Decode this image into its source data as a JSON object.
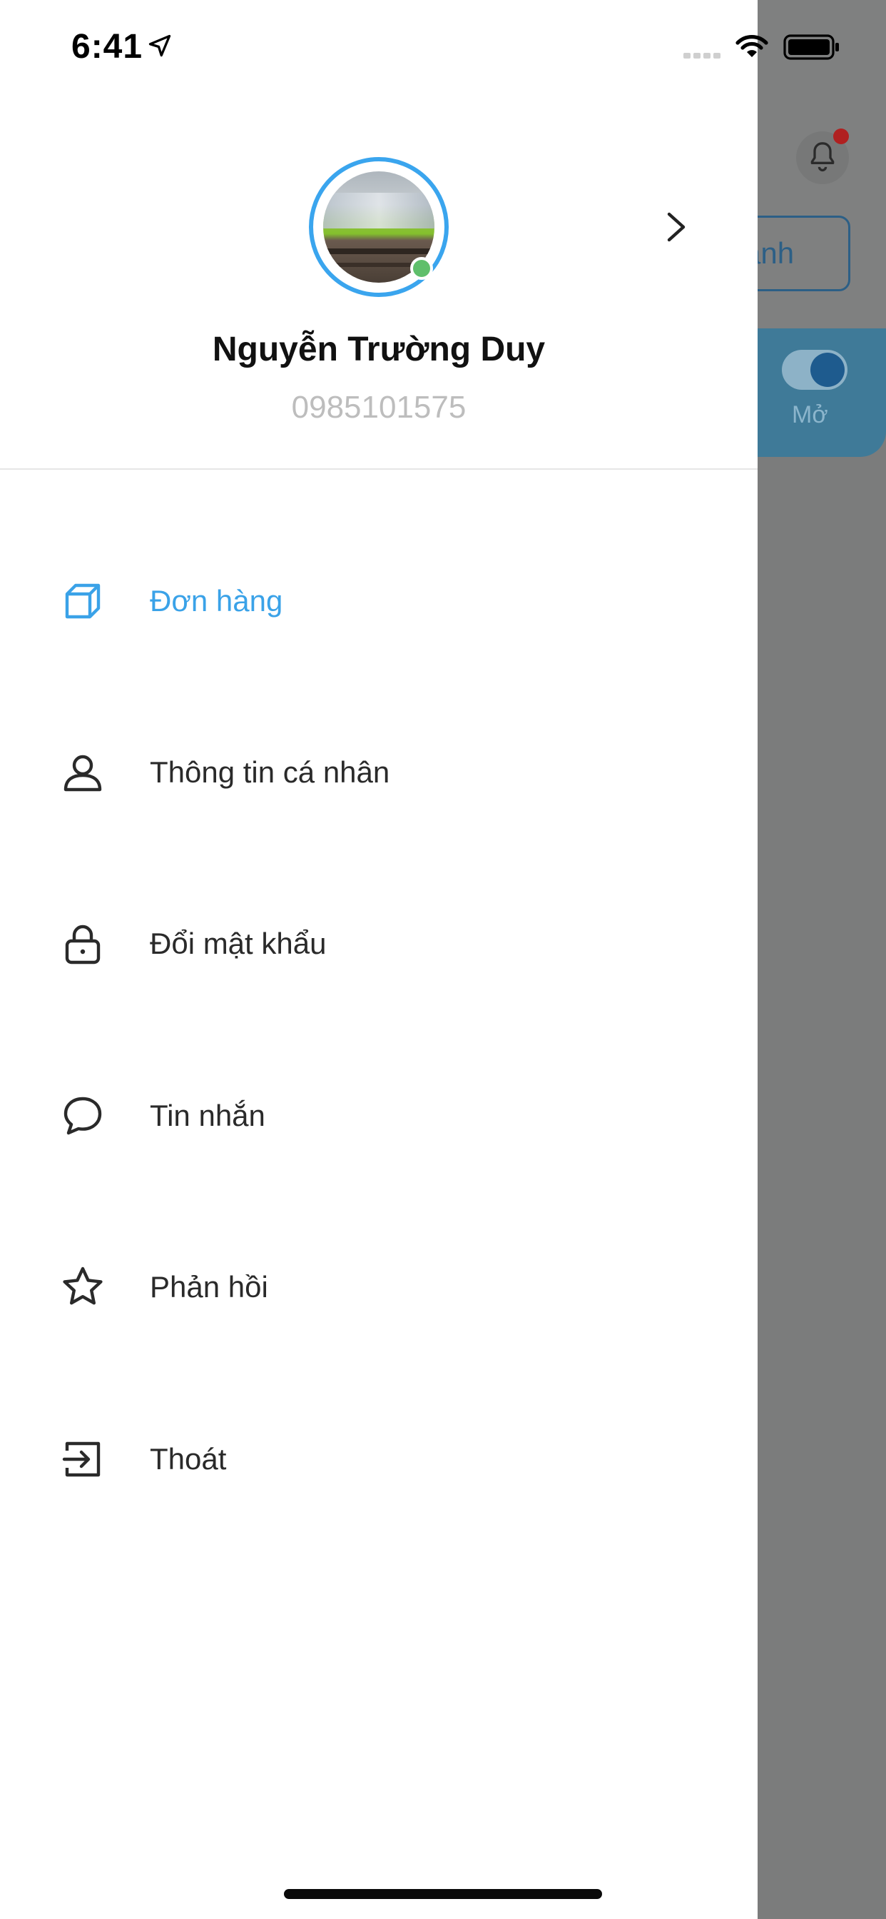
{
  "status_bar": {
    "time": "6:41"
  },
  "profile": {
    "name": "Nguyễn Trường Duy",
    "phone": "0985101575",
    "online": true
  },
  "menu": {
    "items": [
      {
        "label": "Đơn hàng",
        "icon": "box-icon",
        "active": true
      },
      {
        "label": "Thông tin cá nhân",
        "icon": "user-icon",
        "active": false
      },
      {
        "label": "Đổi mật khẩu",
        "icon": "lock-icon",
        "active": false
      },
      {
        "label": "Tin nhắn",
        "icon": "chat-bubble-icon",
        "active": false
      },
      {
        "label": "Phản hồi",
        "icon": "star-icon",
        "active": false
      },
      {
        "label": "Thoát",
        "icon": "logout-icon",
        "active": false
      }
    ]
  },
  "background_screen": {
    "button_partial_label": "anh",
    "toggle_label": "Mở"
  },
  "colors": {
    "accent": "#3aa2e8",
    "overlay": "#7b7c7c",
    "online": "#5fbf6b"
  }
}
